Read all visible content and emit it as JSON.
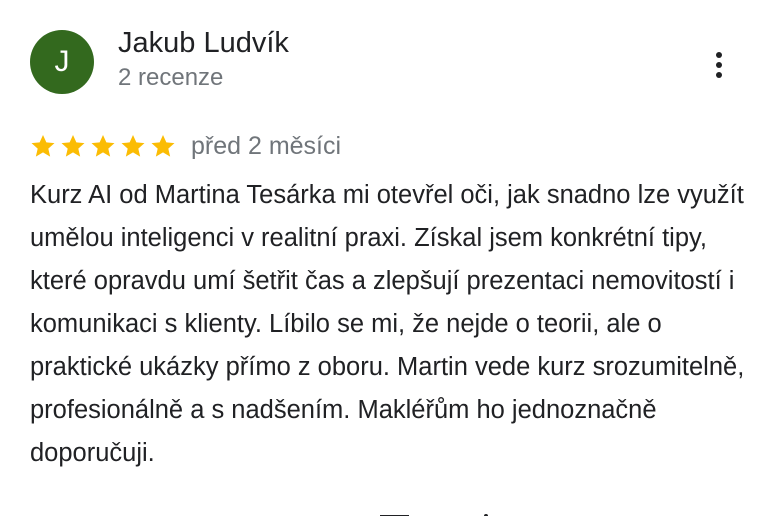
{
  "review": {
    "author": {
      "initial": "J",
      "name": "Jakub Ludvík",
      "review_count": "2 recenze",
      "avatar_color": "#33691e"
    },
    "more_icon": "more-vertical-icon",
    "rating": {
      "stars": 5,
      "max_stars": 5,
      "star_color": "#fbbc04"
    },
    "date": "před 2 měsíci",
    "text": "Kurz AI od Martina Tesárka mi otevřel oči, jak snadno lze využít umělou inteligenci v realitní praxi. Získal jsem konkrétní tipy, které opravdu umí šetřit čas a zlepšují prezentaci nemovitostí i komunikaci s klienty. Líbilo se mi, že nejde o teorii, ale o praktické ukázky přímo z oboru. Martin vede kurz srozumitelně, profesionálně a s nadšením. Makléřům ho jednoznačně doporučuji."
  },
  "next_section_fragment": "Zemnit"
}
